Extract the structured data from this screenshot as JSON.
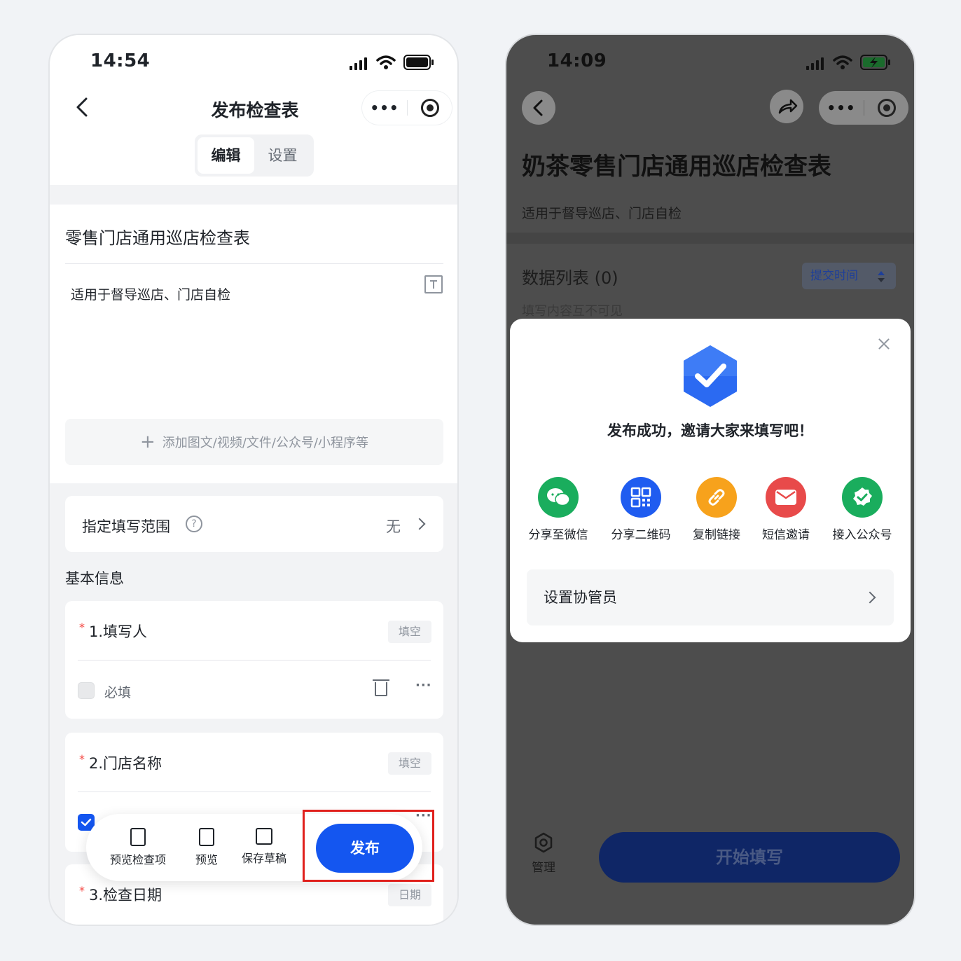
{
  "left_screen": {
    "status_time": "14:54",
    "nav_title": "发布检查表",
    "capsule_more": "•••",
    "tabs": [
      {
        "label": "编辑",
        "active": true
      },
      {
        "label": "设置",
        "active": false
      }
    ],
    "form_title": "零售门店通用巡店检查表",
    "form_description": "适用于督导巡店、门店自检",
    "add_media_label": "添加图文/视频/文件/公众号/小程序等",
    "range": {
      "label": "指定填写范围",
      "help": "?",
      "value": "无"
    },
    "section_title": "基本信息",
    "questions": [
      {
        "star": "*",
        "title": "1.填写人",
        "tag": "填空",
        "required_label": "必填",
        "required_checked": false,
        "more": "···"
      },
      {
        "star": "*",
        "title": "2.门店名称",
        "tag": "填空",
        "required_checked": true,
        "more": "···"
      },
      {
        "star": "*",
        "title": "3.检查日期",
        "tag": "日期"
      }
    ],
    "toolbar": {
      "preview_items_label": "预览检查项",
      "preview_label": "预览",
      "save_draft_label": "保存草稿",
      "publish_label": "发布"
    },
    "highlight_color": "#e0201c"
  },
  "right_screen": {
    "status_time": "14:09",
    "capsule_more": "•••",
    "form_title": "奶茶零售门店通用巡店检查表",
    "form_description": "适用于督导巡店、门店自检",
    "data_list_label": "数据列表 (0)",
    "sort_label": "提交时间",
    "visibility_hint": "填写内容互不可见",
    "modal": {
      "title": "发布成功，邀请大家来填写吧！",
      "share_options": [
        {
          "label": "分享至微信",
          "icon": "wechat-icon",
          "color": "#1aad5d"
        },
        {
          "label": "分享二维码",
          "icon": "qrcode-icon",
          "color": "#1f5cf0"
        },
        {
          "label": "复制链接",
          "icon": "link-icon",
          "color": "#f7a21c"
        },
        {
          "label": "短信邀请",
          "icon": "mail-icon",
          "color": "#e84a4a"
        },
        {
          "label": "接入公众号",
          "icon": "official-account-icon",
          "color": "#1aad5d"
        }
      ],
      "co_admin_label": "设置协管员"
    },
    "manage_label": "管理",
    "start_label": "开始填写"
  },
  "colors": {
    "primary": "#1456f0",
    "overlay": "#4d4d4d"
  }
}
